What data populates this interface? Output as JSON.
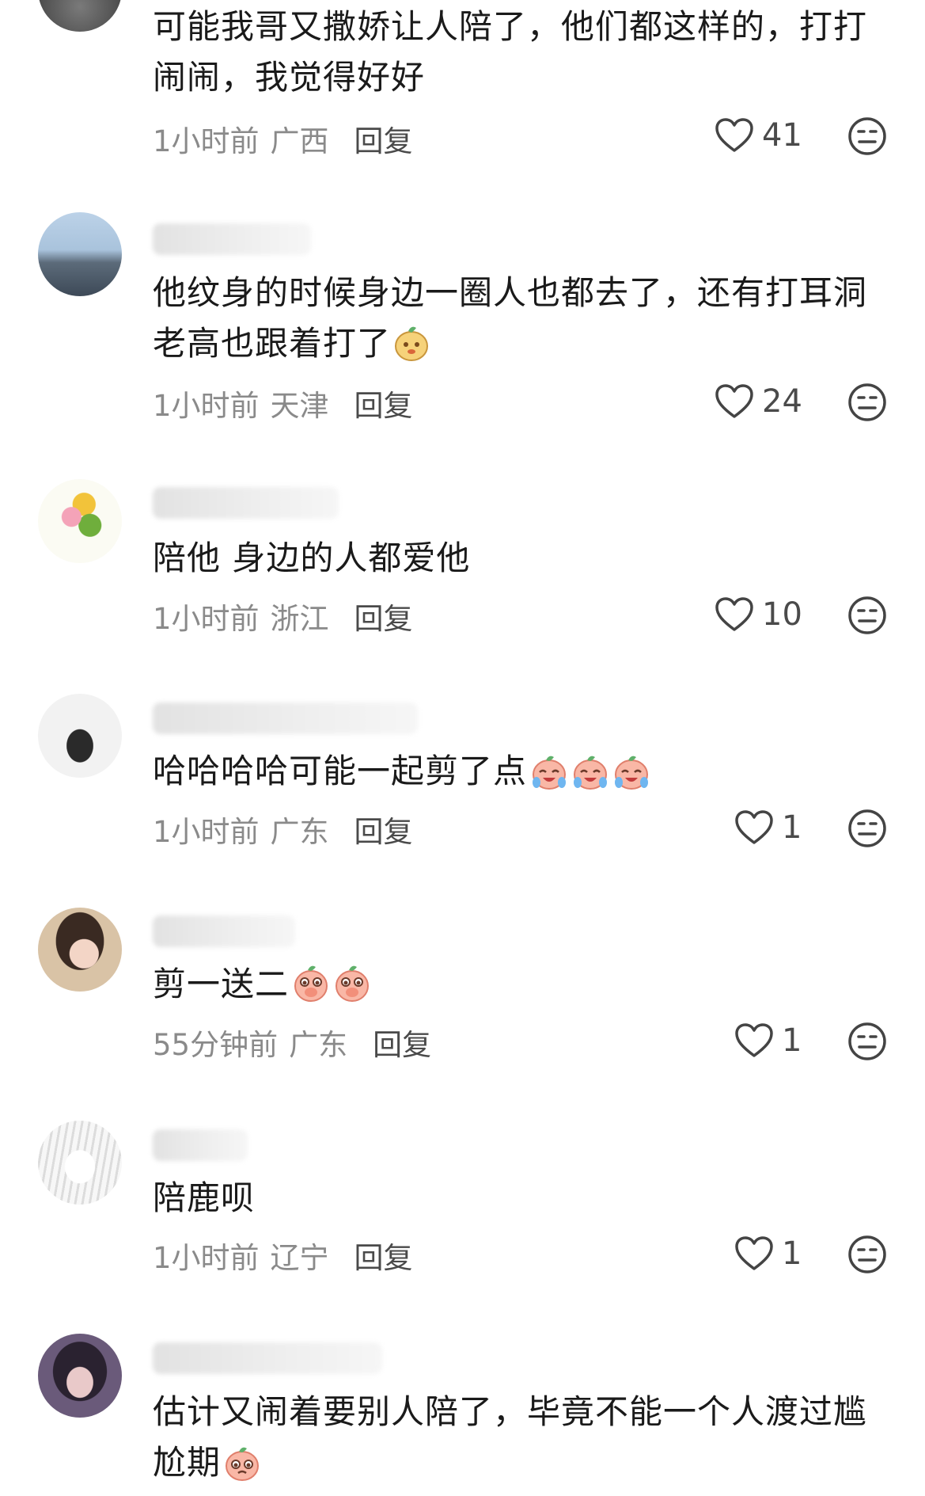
{
  "reply_label": "回复",
  "comments": [
    {
      "text": "可能我哥又撒娇让人陪了，他们都这样的，打打闹闹，我觉得好好",
      "time": "1小时前",
      "region": "广西",
      "likes": "41"
    },
    {
      "text": "他纹身的时候身边一圈人也都去了，还有打耳洞老高也跟着打了",
      "time": "1小时前",
      "region": "天津",
      "likes": "24"
    },
    {
      "text": "陪他 身边的人都爱他",
      "time": "1小时前",
      "region": "浙江",
      "likes": "10"
    },
    {
      "text": "哈哈哈哈可能一起剪了点",
      "time": "1小时前",
      "region": "广东",
      "likes": "1"
    },
    {
      "text": "剪一送二",
      "time": "55分钟前",
      "region": "广东",
      "likes": "1"
    },
    {
      "text": "陪鹿呗",
      "time": "1小时前",
      "region": "辽宁",
      "likes": "1"
    },
    {
      "text": "估计又闹着要别人陪了，毕竟不能一个人渡过尴尬期",
      "time": "",
      "region": "",
      "likes": ""
    }
  ]
}
